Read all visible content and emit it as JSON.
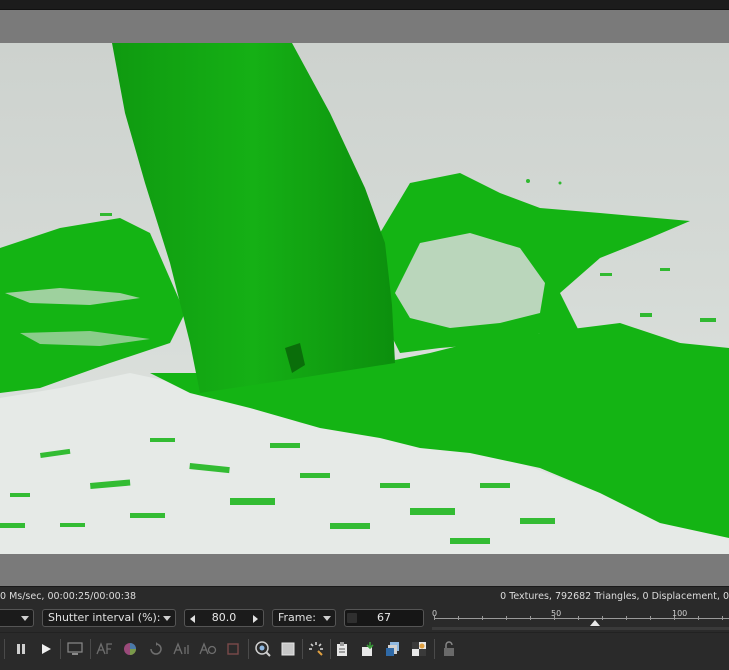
{
  "status": {
    "left": "0 Ms/sec, 00:00:25/00:00:38",
    "right": "0 Textures, 792682 Triangles, 0 Displacement, 0"
  },
  "controls": {
    "first_dropdown": "",
    "shutter_label": "Shutter interval (%):",
    "shutter_value": "80.0",
    "frame_label": "Frame:",
    "frame_value": "67"
  },
  "timeline": {
    "ticks": [
      "0",
      "50",
      "100"
    ],
    "current_frame": 67
  },
  "colors": {
    "fluid": "#14b414",
    "floor": "#d3d8d4",
    "panel": "#2a2a2a"
  },
  "toolbar": {
    "icons": [
      "pause-icon",
      "play-icon",
      "monitor-icon",
      "af-icon",
      "color-wheel-icon",
      "refresh-icon",
      "af-icon",
      "af-icon",
      "stop-icon",
      "camera-target-icon",
      "region-icon",
      "loading-icon",
      "clipboard-icon",
      "import-icon",
      "layers-icon",
      "checker-icon",
      "lock-icon"
    ]
  }
}
